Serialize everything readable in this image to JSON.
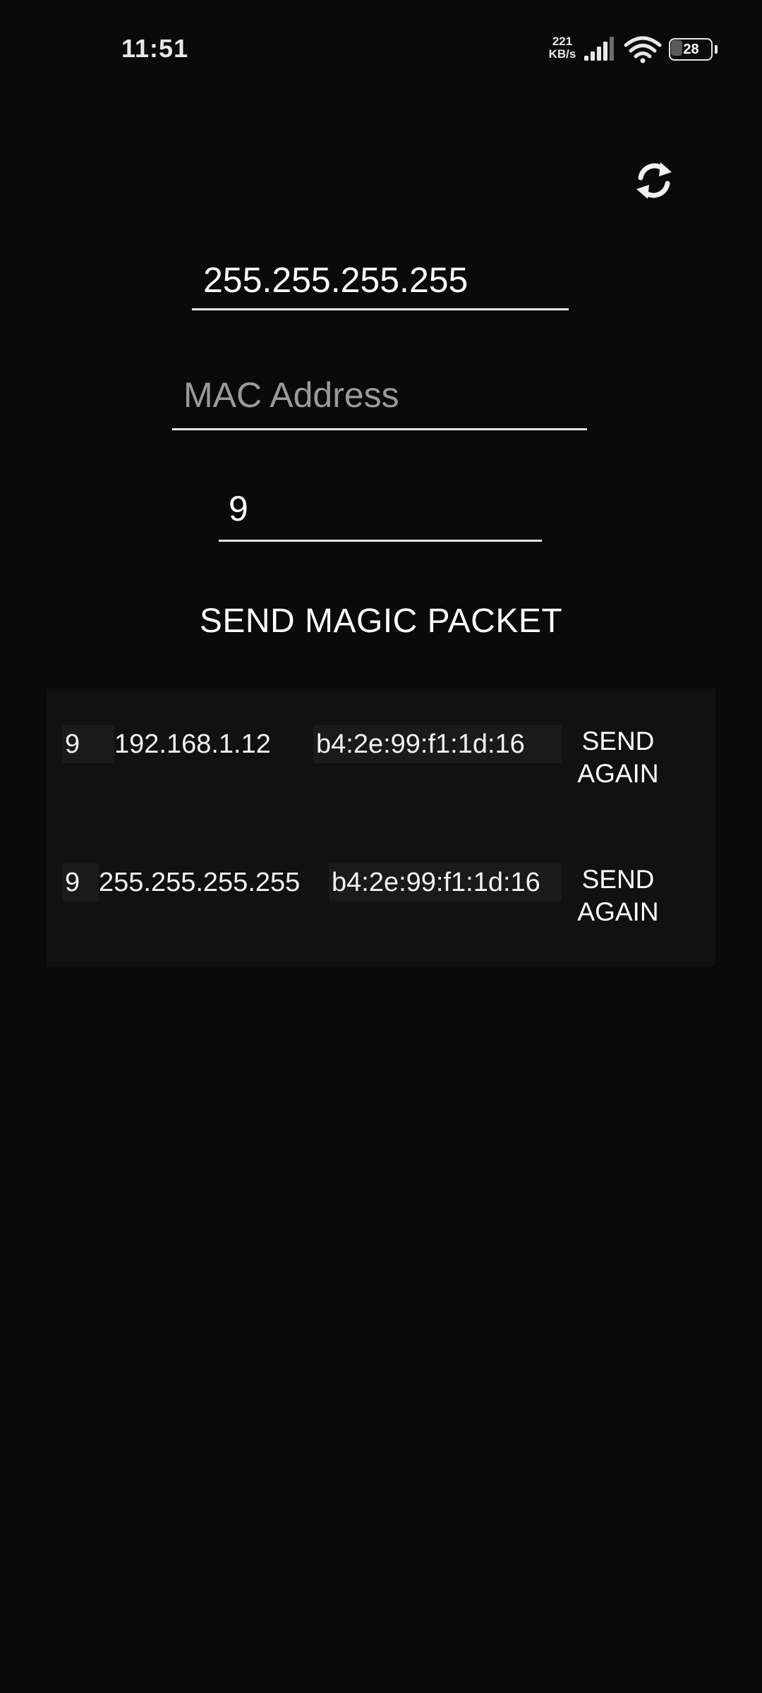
{
  "status_bar": {
    "time": "11:51",
    "net_speed_value": "221",
    "net_speed_unit": "KB/s",
    "battery_level": "28",
    "battery_fraction": 0.28
  },
  "toolbar": {
    "refresh_icon": "refresh-icon"
  },
  "form": {
    "ip_value": "255.255.255.255",
    "mac_placeholder": "MAC Address",
    "mac_value": "",
    "port_value": "9",
    "send_label": "SEND MAGIC PACKET"
  },
  "history": [
    {
      "port": "9",
      "ip": "192.168.1.12",
      "mac": "b4:2e:99:f1:1d:16",
      "action_line1": "SEND",
      "action_line2": "AGAIN"
    },
    {
      "port": "9",
      "ip": "255.255.255.255",
      "mac": "b4:2e:99:f1:1d:16",
      "action_line1": "SEND",
      "action_line2": "AGAIN"
    }
  ],
  "colors": {
    "background": "#0a0a0a",
    "history_background": "#111111",
    "text": "#ffffff",
    "placeholder": "#9a9a9a",
    "underline": "#e6e6e6"
  }
}
